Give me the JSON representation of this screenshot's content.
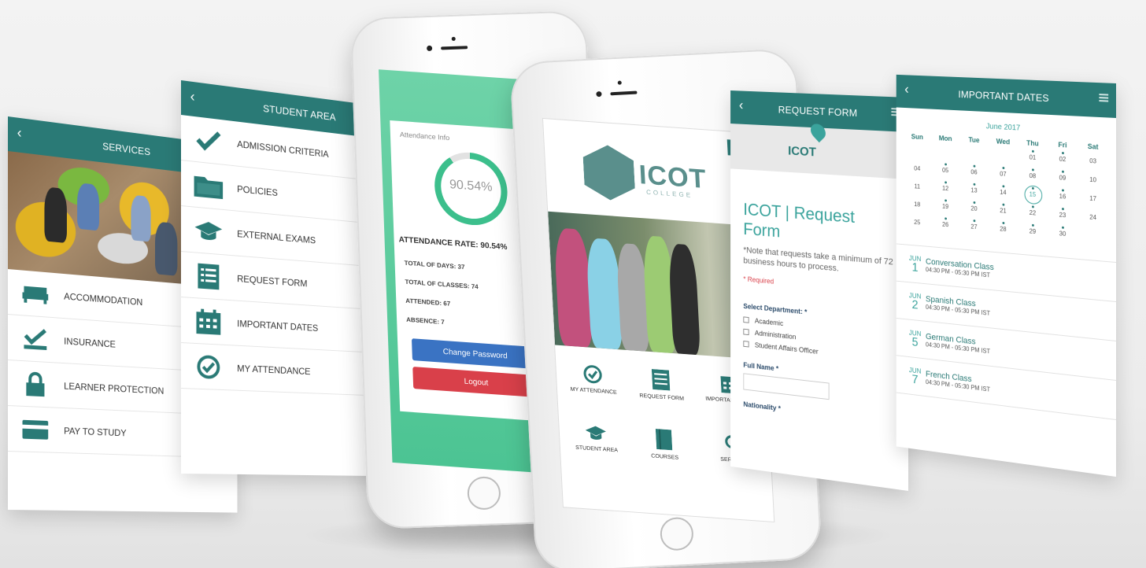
{
  "services": {
    "title": "SERVICES",
    "items": [
      {
        "label": "ACCOMMODATION"
      },
      {
        "label": "INSURANCE"
      },
      {
        "label": "LEARNER PROTECTION"
      },
      {
        "label": "PAY TO STUDY"
      }
    ]
  },
  "student_area": {
    "title": "STUDENT AREA",
    "items": [
      {
        "label": "ADMISSION CRITERIA"
      },
      {
        "label": "POLICIES"
      },
      {
        "label": "EXTERNAL EXAMS"
      },
      {
        "label": "REQUEST FORM"
      },
      {
        "label": "IMPORTANT DATES"
      },
      {
        "label": "MY ATTENDANCE"
      }
    ]
  },
  "attendance": {
    "info_label": "Attendance Info",
    "percent_label": "90.54%",
    "percent_value": 90.54,
    "rate_label": "ATTENDANCE RATE: 90.54%",
    "total_days": "TOTAL OF DAYS: 37",
    "total_classes": "TOTAL OF CLASSES: 74",
    "attended": "ATTENDED: 67",
    "absence": "ABSENCE: 7",
    "change_password": "Change Password",
    "logout": "Logout"
  },
  "home": {
    "logo": "ICOT",
    "logo_sub": "COLLEGE",
    "tiles": [
      {
        "label": "MY ATTENDANCE",
        "icon": "check-circle-icon"
      },
      {
        "label": "REQUEST FORM",
        "icon": "form-icon"
      },
      {
        "label": "IMPORTANT DATES",
        "icon": "calendar-icon"
      },
      {
        "label": "STUDENT AREA",
        "icon": "graduation-cap-icon"
      },
      {
        "label": "COURSES",
        "icon": "book-icon"
      },
      {
        "label": "SERVICES",
        "icon": "search-icon"
      }
    ]
  },
  "request_form": {
    "title": "REQUEST FORM",
    "logo": "ICOT",
    "heading": "ICOT | Request Form",
    "note": "*Note that requests take a minimum of 72 business hours to process.",
    "required": "* Required",
    "department_label": "Select Department: *",
    "departments": [
      "Academic",
      "Administration",
      "Student Affairs Officer"
    ],
    "full_name_label": "Full Name *",
    "nationality_label": "Nationality *"
  },
  "important_dates": {
    "title": "IMPORTANT DATES",
    "month": "June 2017",
    "weekdays": [
      "Sun",
      "Mon",
      "Tue",
      "Wed",
      "Thu",
      "Fri",
      "Sat"
    ],
    "events": [
      {
        "month": "JUN",
        "day": "1",
        "title": "Conversation Class",
        "time": "04:30 PM - 05:30 PM IST"
      },
      {
        "month": "JUN",
        "day": "2",
        "title": "Spanish Class",
        "time": "04:30 PM - 05:30 PM IST"
      },
      {
        "month": "JUN",
        "day": "5",
        "title": "German Class",
        "time": "04:30 PM - 05:30 PM IST"
      },
      {
        "month": "JUN",
        "day": "7",
        "title": "French Class",
        "time": "04:30 PM - 05:30 PM IST"
      }
    ]
  },
  "colors": {
    "brand": "#2a7a76",
    "accent": "#3aa39c",
    "attendance_green": "#4cc493",
    "button_blue": "#3a73c3",
    "button_red": "#d9404a"
  }
}
